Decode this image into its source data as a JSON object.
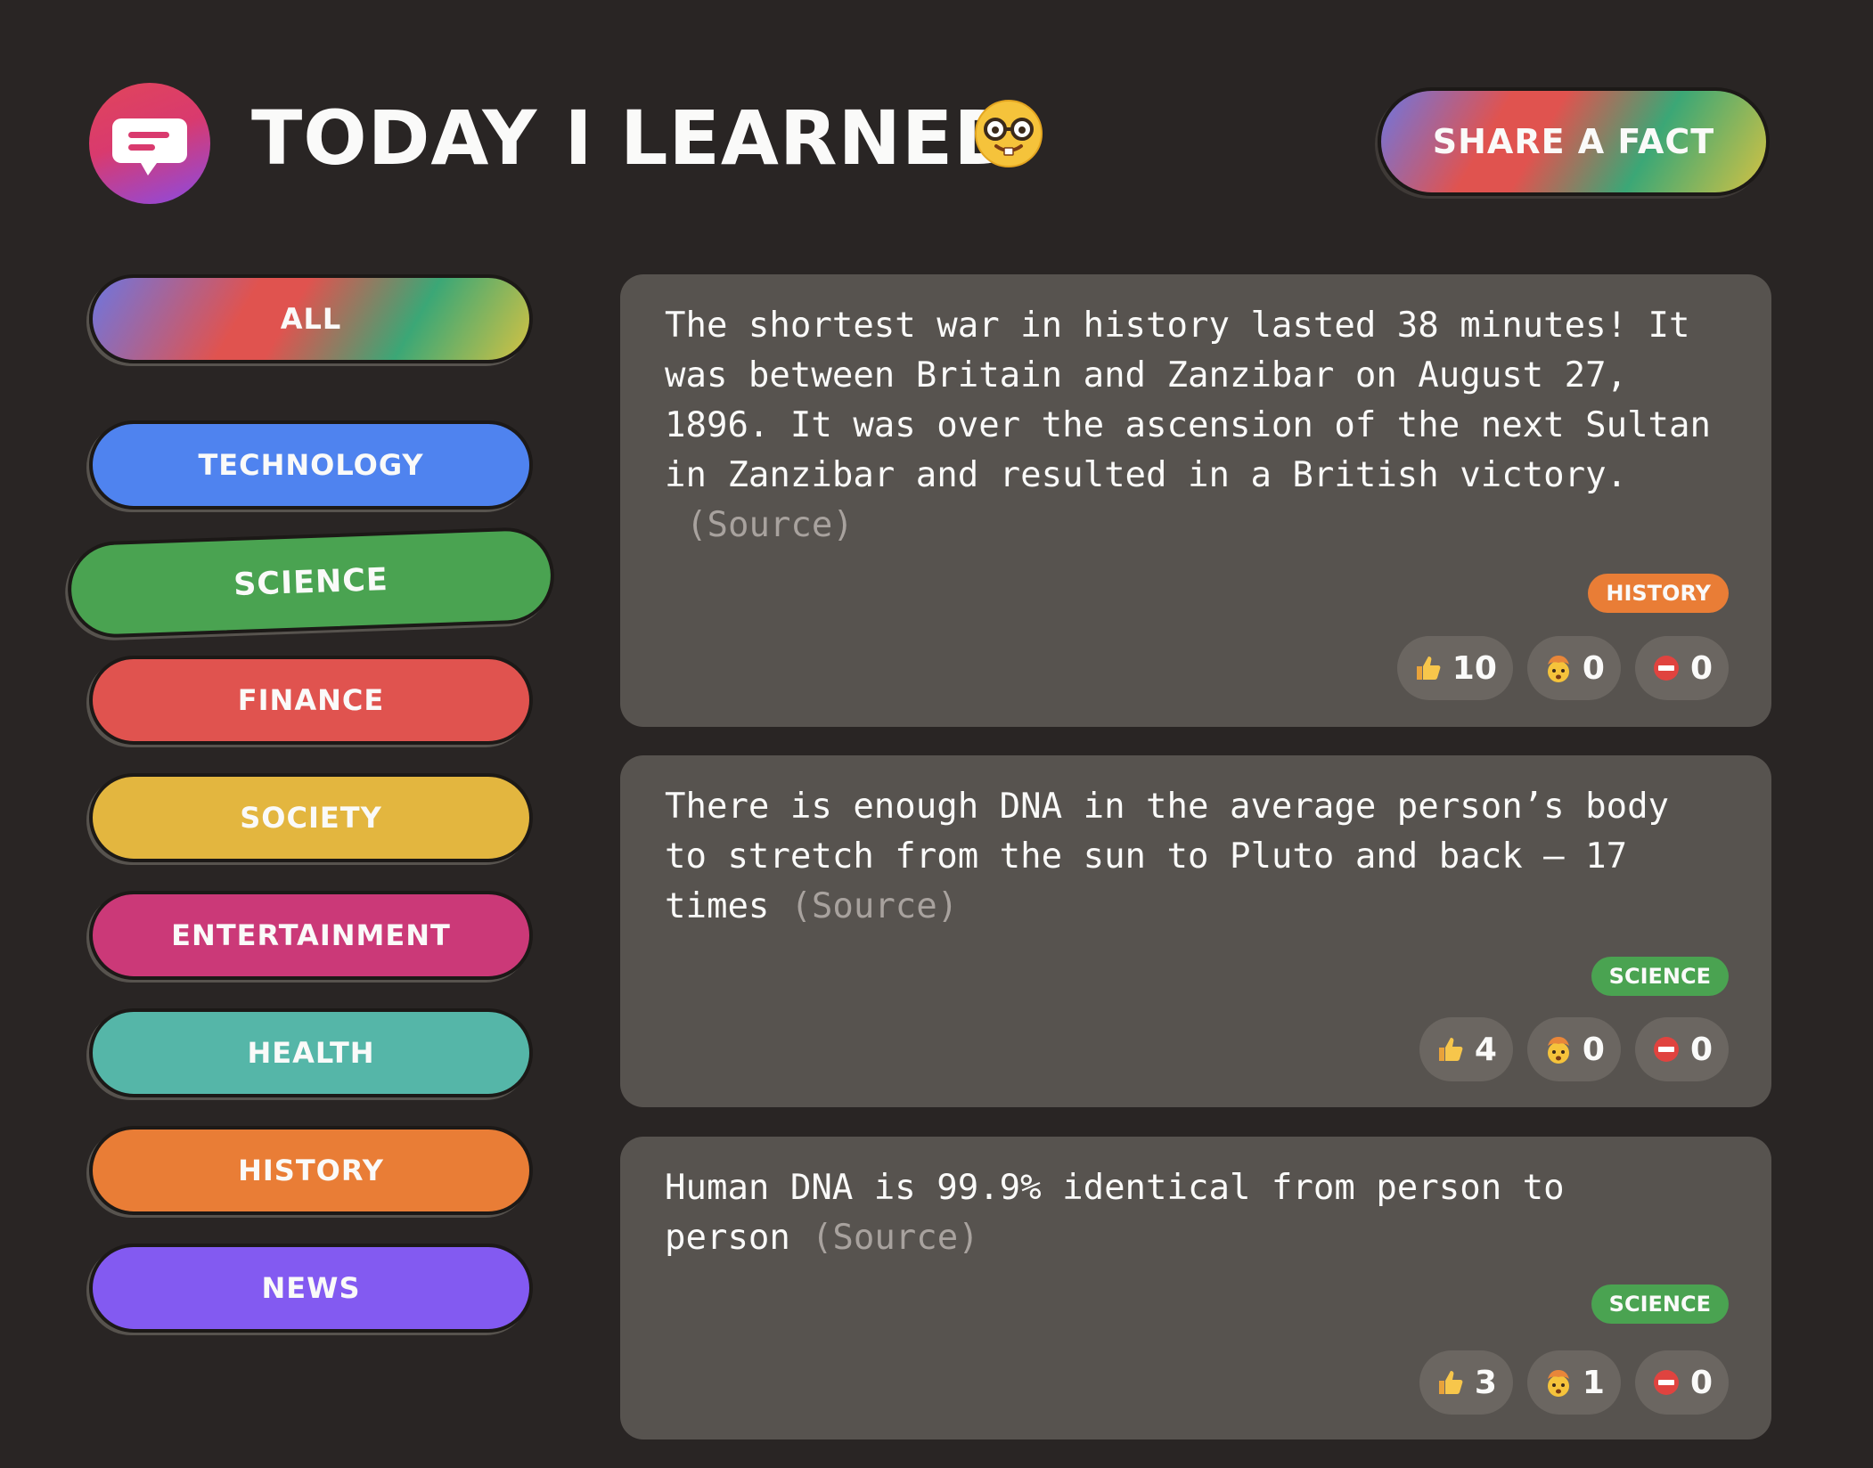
{
  "header": {
    "title": "Today I Learned",
    "title_emoji": "nerd-face",
    "share_button_label": "Share a fact"
  },
  "sidebar": {
    "categories": [
      {
        "label": "All",
        "color": "gradient"
      },
      {
        "label": "Technology",
        "color": "#4f83ef"
      },
      {
        "label": "Science",
        "color": "#4aa351",
        "selected": true
      },
      {
        "label": "Finance",
        "color": "#e0534f"
      },
      {
        "label": "Society",
        "color": "#e3b63f"
      },
      {
        "label": "Entertainment",
        "color": "#cb3978"
      },
      {
        "label": "Health",
        "color": "#55b6a8"
      },
      {
        "label": "History",
        "color": "#e97d36"
      },
      {
        "label": "News",
        "color": "#835af1"
      }
    ]
  },
  "facts": [
    {
      "text": "The shortest war in history lasted 38 minutes! It was between Britain and Zanzibar on August 27, 1896. It was over the ascension of the next Sultan in Zanzibar and resulted in a British victory.",
      "source_label": "(Source)",
      "category": "history",
      "category_color": "#e97d36",
      "votes": {
        "interesting": "10",
        "mindblowing": "0",
        "false": "0"
      }
    },
    {
      "text": "There is enough DNA in the average person’s body to stretch from the sun to Pluto and back — 17 times",
      "source_label": "(Source)",
      "category": "science",
      "category_color": "#4aa351",
      "votes": {
        "interesting": "4",
        "mindblowing": "0",
        "false": "0"
      }
    },
    {
      "text": "Human DNA is 99.9% identical from person to person",
      "source_label": "(Source)",
      "category": "science",
      "category_color": "#4aa351",
      "votes": {
        "interesting": "3",
        "mindblowing": "1",
        "false": "0"
      }
    }
  ],
  "vote_icons": [
    "thumbs-up-icon",
    "exploding-head-icon",
    "no-entry-icon"
  ],
  "colors": {
    "background": "#292524",
    "card": "#57534f",
    "text": "#fafaf9",
    "muted": "#a8a29e"
  }
}
